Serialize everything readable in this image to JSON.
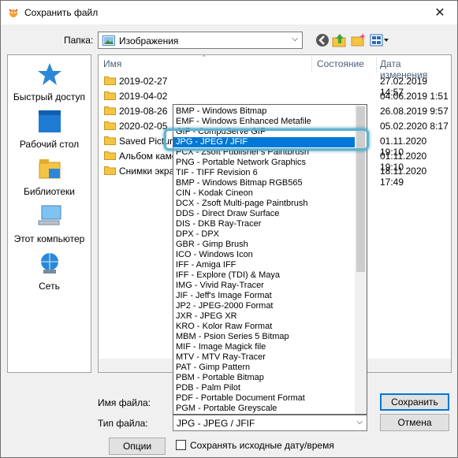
{
  "window": {
    "title": "Сохранить файл",
    "close_glyph": "✕"
  },
  "folder": {
    "label": "Папка:",
    "value": "Изображения",
    "arrow": "⌵"
  },
  "nav_icons": [
    "back-icon",
    "up-folder-icon",
    "new-folder-icon",
    "view-menu-icon"
  ],
  "places": [
    {
      "label": "Быстрый доступ",
      "icon": "star-icon"
    },
    {
      "label": "Рабочий стол",
      "icon": "desktop-icon"
    },
    {
      "label": "Библиотеки",
      "icon": "libraries-icon"
    },
    {
      "label": "Этот компьютер",
      "icon": "computer-icon"
    },
    {
      "label": "Сеть",
      "icon": "network-icon"
    }
  ],
  "columns": {
    "name": "Имя",
    "status": "Состояние",
    "date": "Дата изменения"
  },
  "files": [
    {
      "name": "2019-02-27",
      "date": "27.02.2019 14:57"
    },
    {
      "name": "2019-04-02",
      "date": "04.06.2019 1:51"
    },
    {
      "name": "2019-08-26",
      "date": "26.08.2019 9:57"
    },
    {
      "name": "2020-02-05",
      "date": "05.02.2020 8:17"
    },
    {
      "name": "Saved Pictures",
      "date": "01.11.2020 19:10"
    },
    {
      "name": "Альбом камеры",
      "date": "01.11.2020 19:10"
    },
    {
      "name": "Снимки экрана",
      "date": "18.11.2020 17:49"
    }
  ],
  "filename_label": "Имя файла:",
  "filetype": {
    "label": "Тип файла:",
    "value": "JPG - JPEG / JFIF",
    "arrow": "⌵"
  },
  "buttons": {
    "save": "Сохранить",
    "cancel": "Отмена",
    "options": "Опции"
  },
  "keep_date": {
    "label": "Сохранять исходные дату/время",
    "checked": false
  },
  "dropdown": {
    "selected_index": 3,
    "items": [
      "BMP - Windows Bitmap",
      "EMF - Windows Enhanced Metafile",
      "GIF - CompuServe GIF",
      "JPG - JPEG / JFIF",
      "PCX - Zsoft Publisher's Paintbrush",
      "PNG - Portable Network Graphics",
      "TIF - TIFF Revision 6",
      "BMP - Windows Bitmap RGB565",
      "CIN - Kodak Cineon",
      "DCX - Zsoft Multi-page Paintbrush",
      "DDS - Direct Draw Surface",
      "DIS - DKB Ray-Tracer",
      "DPX - DPX",
      "GBR - Gimp Brush",
      "ICO - Windows Icon",
      "IFF - Amiga IFF",
      "IFF - Explore (TDI) & Maya",
      "IMG - Vivid Ray-Tracer",
      "JIF - Jeff's Image Format",
      "JP2 - JPEG-2000 Format",
      "JXR - JPEG XR",
      "KRO - Kolor Raw Format",
      "MBM - Psion Series 5 Bitmap",
      "MIF - Image Magick file",
      "MTV - MTV Ray-Tracer",
      "PAT - Gimp Pattern",
      "PBM - Portable Bitmap",
      "PDB - Palm Pilot",
      "PDF - Portable Document Format",
      "PGM - Portable Greyscale"
    ]
  },
  "colors": {
    "accent": "#0078d7",
    "highlight": "#5fb2cf",
    "folder": "#f4c542"
  }
}
